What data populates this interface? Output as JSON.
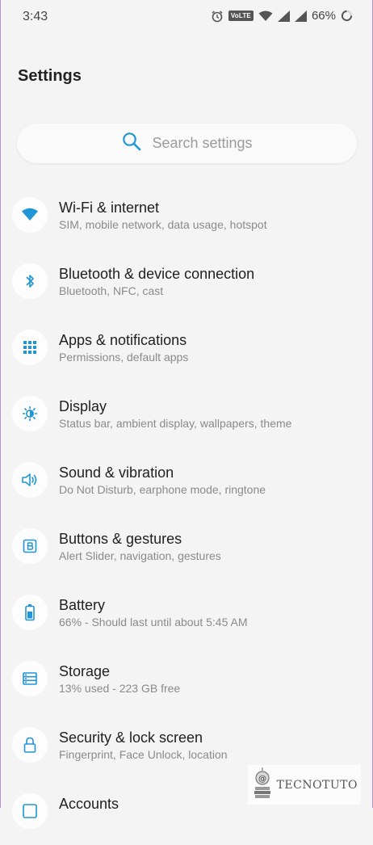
{
  "status_bar": {
    "time": "3:43",
    "volte": "VoLTE",
    "battery_percent": "66%"
  },
  "header": {
    "title": "Settings"
  },
  "search": {
    "placeholder": "Search settings"
  },
  "colors": {
    "accent": "#2196d6",
    "background": "#f4f4f4",
    "subtitle": "#8a8a8a"
  },
  "settings": [
    {
      "title": "Wi-Fi & internet",
      "subtitle": "SIM, mobile network, data usage, hotspot",
      "icon": "wifi-icon"
    },
    {
      "title": "Bluetooth & device connection",
      "subtitle": "Bluetooth, NFC, cast",
      "icon": "bluetooth-icon"
    },
    {
      "title": "Apps & notifications",
      "subtitle": "Permissions, default apps",
      "icon": "apps-grid-icon"
    },
    {
      "title": "Display",
      "subtitle": "Status bar, ambient display, wallpapers, theme",
      "icon": "brightness-icon"
    },
    {
      "title": "Sound & vibration",
      "subtitle": "Do Not Disturb, earphone mode, ringtone",
      "icon": "speaker-icon"
    },
    {
      "title": "Buttons & gestures",
      "subtitle": "Alert Slider, navigation, gestures",
      "icon": "button-b-icon"
    },
    {
      "title": "Battery",
      "subtitle": "66% - Should last until about 5:45 AM",
      "icon": "battery-icon"
    },
    {
      "title": "Storage",
      "subtitle": "13% used - 223 GB free",
      "icon": "storage-icon"
    },
    {
      "title": "Security & lock screen",
      "subtitle": "Fingerprint, Face Unlock, location",
      "icon": "lock-icon"
    },
    {
      "title": "Accounts",
      "subtitle": "",
      "icon": "account-icon"
    }
  ],
  "watermark": {
    "text": "TECNOTUTO"
  }
}
